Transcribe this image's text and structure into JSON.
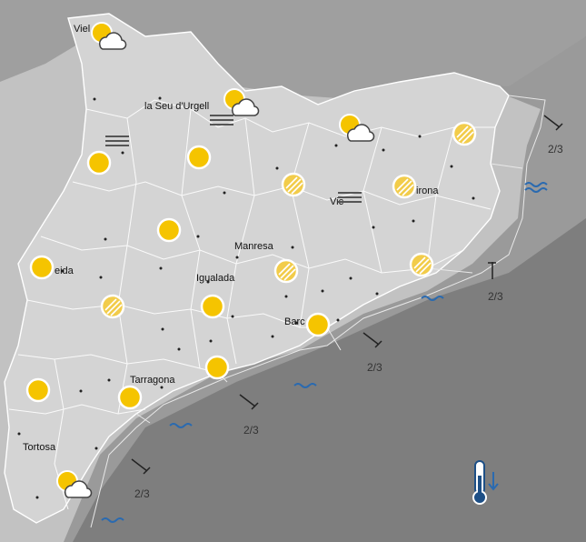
{
  "cities": [
    {
      "id": "viella",
      "name": "Viel"
    },
    {
      "id": "seu",
      "name": "la Seu d'Urgell"
    },
    {
      "id": "vic",
      "name": "Vic"
    },
    {
      "id": "girona",
      "name": "irona"
    },
    {
      "id": "manresa",
      "name": "Manresa"
    },
    {
      "id": "lleida",
      "name": "eida"
    },
    {
      "id": "igualada",
      "name": "Igualada"
    },
    {
      "id": "barcelona",
      "name": "Barc"
    },
    {
      "id": "tarragona",
      "name": "Tarragona"
    },
    {
      "id": "tortosa",
      "name": "Tortosa"
    }
  ],
  "weather_icons": [
    {
      "id": "viella",
      "type": "sun-cloud"
    },
    {
      "id": "pyrenees-center",
      "type": "sun-cloud"
    },
    {
      "id": "pyrenees-east",
      "type": "sun-cloud"
    },
    {
      "id": "north-west",
      "type": "sun"
    },
    {
      "id": "seu-south",
      "type": "sun"
    },
    {
      "id": "central-north",
      "type": "hazy-sun"
    },
    {
      "id": "garrotxa",
      "type": "hazy-sun"
    },
    {
      "id": "emporda",
      "type": "hazy-sun"
    },
    {
      "id": "solsones",
      "type": "sun"
    },
    {
      "id": "lleida",
      "type": "sun"
    },
    {
      "id": "bages",
      "type": "hazy-sun"
    },
    {
      "id": "maresme",
      "type": "hazy-sun"
    },
    {
      "id": "urgell",
      "type": "hazy-sun"
    },
    {
      "id": "anoia",
      "type": "sun"
    },
    {
      "id": "barcelona",
      "type": "sun"
    },
    {
      "id": "penedes",
      "type": "sun"
    },
    {
      "id": "terra-alta",
      "type": "sun"
    },
    {
      "id": "tarragona",
      "type": "sun"
    },
    {
      "id": "delta",
      "type": "sun-cloud"
    }
  ],
  "fog_icons": [
    "fog-1",
    "fog-2",
    "fog-3"
  ],
  "wind": [
    {
      "id": "wind-ne",
      "label": "2/3"
    },
    {
      "id": "wind-costa",
      "label": "2/3"
    },
    {
      "id": "wind-bcn",
      "label": "2/3"
    },
    {
      "id": "wind-tgn",
      "label": "2/3"
    },
    {
      "id": "wind-ebre",
      "label": "2/3"
    }
  ],
  "sea_states": [
    "sea-ne",
    "sea-costa",
    "sea-bcn",
    "sea-tgn",
    "sea-south",
    "sea-ebre"
  ],
  "thermometer_trend": "down"
}
